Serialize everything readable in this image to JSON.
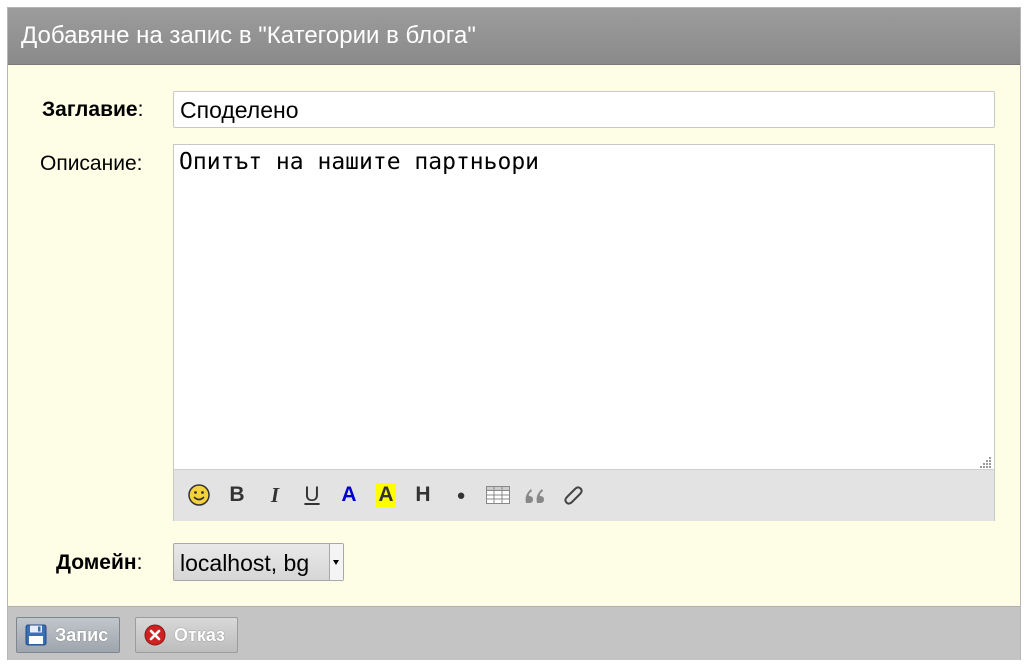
{
  "dialog": {
    "title": "Добавяне на запис в \"Категории в блога\""
  },
  "form": {
    "title_label": "Заглавие",
    "title_value": "Споделено",
    "description_label": "Описание",
    "description_value": "Опитът на нашите партньори",
    "domain_label": "Домейн",
    "domain_value": "localhost, bg",
    "colon": ":"
  },
  "toolbar": {
    "buttons": [
      {
        "name": "smiley-icon",
        "label": ""
      },
      {
        "name": "bold-button",
        "label": "B"
      },
      {
        "name": "italic-button",
        "label": "I"
      },
      {
        "name": "underline-button",
        "label": "U"
      },
      {
        "name": "text-color-button",
        "label": "A"
      },
      {
        "name": "highlight-button",
        "label": "A"
      },
      {
        "name": "heading-button",
        "label": "H"
      },
      {
        "name": "bullet-button",
        "label": "●"
      },
      {
        "name": "table-icon",
        "label": ""
      },
      {
        "name": "quote-icon",
        "label": ""
      },
      {
        "name": "attachment-icon",
        "label": ""
      }
    ],
    "colors": {
      "text_color": "#0000cc",
      "highlight": "#ffff00"
    }
  },
  "footer": {
    "save_label": "Запис",
    "cancel_label": "Отказ"
  },
  "colors": {
    "body_bg": "#fefde6",
    "title_bar": "#8f8f8f",
    "footer_bg": "#c4c4c4",
    "cancel_icon": "#cc2222"
  }
}
